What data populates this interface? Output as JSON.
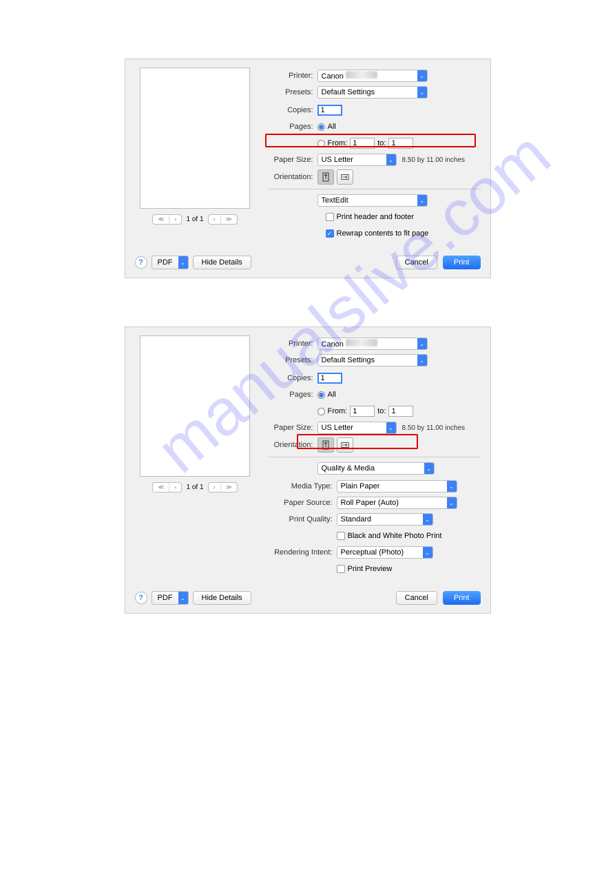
{
  "watermark": "manualslive.com",
  "dialog1": {
    "printer_label": "Printer:",
    "printer_value": "Canon",
    "presets_label": "Presets:",
    "presets_value": "Default Settings",
    "copies_label": "Copies:",
    "copies_value": "1",
    "pages_label": "Pages:",
    "pages_all": "All",
    "pages_from": "From:",
    "pages_from_value": "1",
    "pages_to": "to:",
    "pages_to_value": "1",
    "papersize_label": "Paper Size:",
    "papersize_value": "US Letter",
    "papersize_note": "8.50 by 11.00 inches",
    "orientation_label": "Orientation:",
    "section_select": "TextEdit",
    "print_header": "Print header and footer",
    "rewrap": "Rewrap contents to fit page",
    "page_indicator": "1 of 1",
    "pdf_label": "PDF",
    "hide_details": "Hide Details",
    "cancel": "Cancel",
    "print": "Print"
  },
  "dialog2": {
    "printer_label": "Printer:",
    "printer_value": "Canon",
    "presets_label": "Presets:",
    "presets_value": "Default Settings",
    "copies_label": "Copies:",
    "copies_value": "1",
    "pages_label": "Pages:",
    "pages_all": "All",
    "pages_from": "From:",
    "pages_from_value": "1",
    "pages_to": "to:",
    "pages_to_value": "1",
    "papersize_label": "Paper Size:",
    "papersize_value": "US Letter",
    "papersize_note": "8.50 by 11.00 inches",
    "orientation_label": "Orientation:",
    "section_select": "Quality & Media",
    "media_type_label": "Media Type:",
    "media_type_value": "Plain Paper",
    "paper_source_label": "Paper Source:",
    "paper_source_value": "Roll Paper (Auto)",
    "print_quality_label": "Print Quality:",
    "print_quality_value": "Standard",
    "bw_photo": "Black and White Photo Print",
    "rendering_label": "Rendering Intent:",
    "rendering_value": "Perceptual (Photo)",
    "print_preview": "Print Preview",
    "page_indicator": "1 of 1",
    "pdf_label": "PDF",
    "hide_details": "Hide Details",
    "cancel": "Cancel",
    "print": "Print"
  }
}
